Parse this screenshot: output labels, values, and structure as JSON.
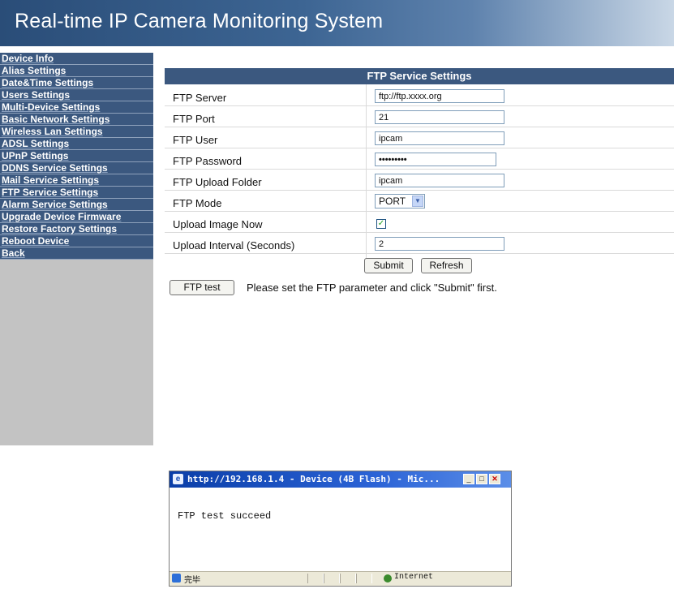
{
  "header": {
    "title": "Real-time IP Camera Monitoring System"
  },
  "sidebar": {
    "items": [
      "Device Info",
      "Alias Settings",
      "Date&Time Settings",
      "Users Settings",
      "Multi-Device Settings",
      "Basic Network Settings",
      "Wireless Lan Settings",
      "ADSL Settings",
      "UPnP Settings",
      "DDNS Service Settings",
      "Mail Service Settings",
      "FTP Service Settings",
      "Alarm Service Settings",
      "Upgrade Device Firmware",
      "Restore Factory Settings",
      "Reboot Device",
      "Back"
    ]
  },
  "ftp": {
    "title": "FTP Service Settings",
    "server_label": "FTP Server",
    "server_value": "ftp://ftp.xxxx.org",
    "port_label": "FTP Port",
    "port_value": "21",
    "user_label": "FTP User",
    "user_value": "ipcam",
    "password_label": "FTP Password",
    "password_value": "•••••••••",
    "folder_label": "FTP Upload Folder",
    "folder_value": "ipcam",
    "mode_label": "FTP Mode",
    "mode_value": "PORT",
    "upload_now_label": "Upload Image Now",
    "upload_now_checked": true,
    "interval_label": "Upload Interval (Seconds)",
    "interval_value": "2",
    "submit_label": "Submit",
    "refresh_label": "Refresh",
    "test_label": "FTP test",
    "hint": "Please set the FTP parameter and click \"Submit\" first."
  },
  "popup": {
    "title": "http://192.168.1.4 - Device (4B Flash) - Mic...",
    "body": "FTP test succeed",
    "status_left": "完毕",
    "status_zone": "Internet"
  },
  "colors": {
    "menu_bg": "#3b587f",
    "sidebar_bg": "#c3c3c3",
    "banner": "#2a4d78"
  }
}
